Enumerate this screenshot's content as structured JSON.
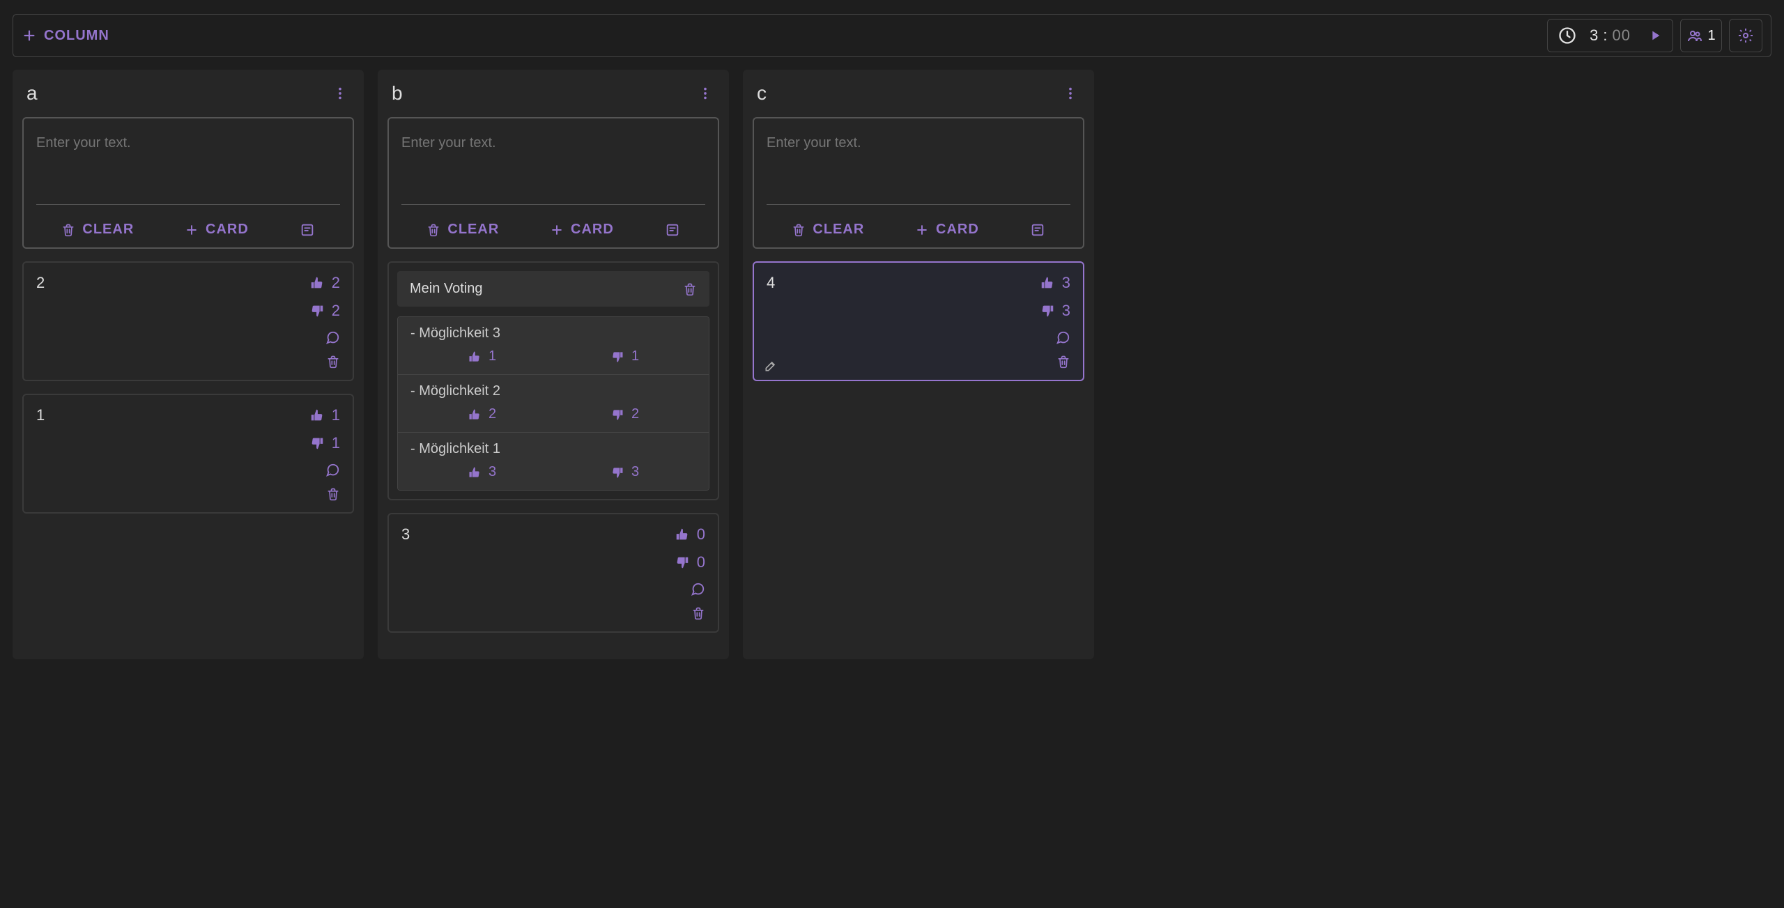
{
  "toolbar": {
    "add_column_label": "COLUMN",
    "timer_minutes": "3",
    "timer_seconds": "00",
    "people_count": "1"
  },
  "new_card": {
    "placeholder": "Enter your text.",
    "clear_label": "CLEAR",
    "card_label": "CARD"
  },
  "columns": [
    {
      "title": "a",
      "cards": [
        {
          "type": "simple",
          "text": "2",
          "up": "2",
          "down": "2"
        },
        {
          "type": "simple",
          "text": "1",
          "up": "1",
          "down": "1"
        }
      ]
    },
    {
      "title": "b",
      "cards": [
        {
          "type": "voting",
          "title": "Mein Voting",
          "options": [
            {
              "label": "- Möglichkeit 3",
              "up": "1",
              "down": "1"
            },
            {
              "label": "- Möglichkeit 2",
              "up": "2",
              "down": "2"
            },
            {
              "label": "- Möglichkeit 1",
              "up": "3",
              "down": "3"
            }
          ]
        },
        {
          "type": "simple",
          "text": "3",
          "up": "0",
          "down": "0"
        }
      ]
    },
    {
      "title": "c",
      "cards": [
        {
          "type": "simple",
          "text": "4",
          "up": "3",
          "down": "3",
          "selected": true,
          "editing": true
        }
      ]
    }
  ]
}
